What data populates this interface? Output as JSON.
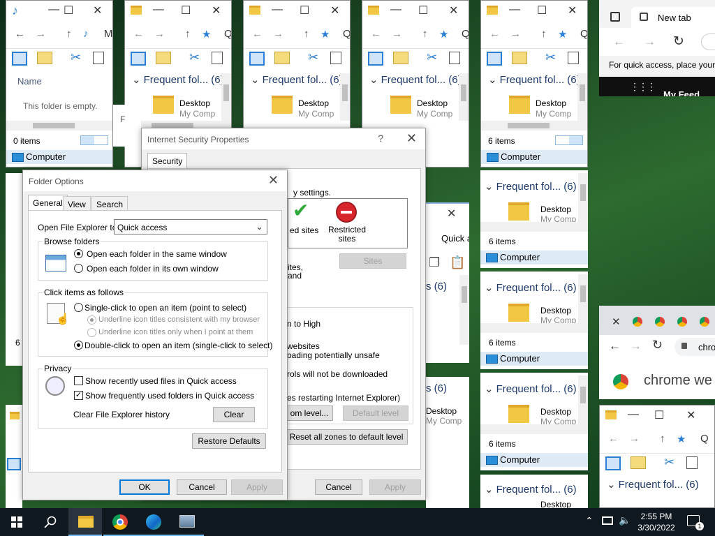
{
  "explorer": {
    "music_window": {
      "column_name": "Name",
      "empty_text": "This folder is empty.",
      "status": "0 items",
      "location": "Computer",
      "address_fragment": "M"
    },
    "frequent_folders": "Frequent fol... (6)",
    "desktop_label": "Desktop",
    "desktop_sub": "My Comp",
    "address_fragment": "Q",
    "status": "6 items",
    "location": "Computer",
    "quick_access_fragment": "Quick a",
    "count_fragment": "s (6)",
    "side_fragment_6": "6",
    "side_fragment_f": "F"
  },
  "internet_security": {
    "title": "Internet Security Properties",
    "help": "?",
    "tab_security": "Security",
    "zone_text_settings": "y settings.",
    "trusted_sites_fragment": "ed sites",
    "restricted_sites": "Restricted sites",
    "sites_button": "Sites",
    "frag_sites": "ites,",
    "frag_and": "and",
    "frag_to_high": "n to High",
    "frag_websites": "websites",
    "frag_unsafe": "oading potentially unsafe",
    "frag_controls": "rols will not be downloaded",
    "frag_restart": "es restarting Internet Explorer)",
    "custom_level": "om level...",
    "default_level": "Default level",
    "reset_all": "Reset all zones to default level",
    "cancel": "Cancel",
    "apply": "Apply"
  },
  "folder_options": {
    "title": "Folder Options",
    "tabs": [
      "General",
      "View",
      "Search"
    ],
    "open_explorer_to_label": "Open File Explorer to:",
    "open_explorer_to_value": "Quick access",
    "browse_folders": {
      "legend": "Browse folders",
      "same_window": "Open each folder in the same window",
      "own_window": "Open each folder in its own window"
    },
    "click_items": {
      "legend": "Click items as follows",
      "single_click": "Single-click to open an item (point to select)",
      "underline_browser": "Underline icon titles consistent with my browser",
      "underline_point": "Underline icon titles only when I point at them",
      "double_click": "Double-click to open an item (single-click to select)"
    },
    "privacy": {
      "legend": "Privacy",
      "recent_files": "Show recently used files in Quick access",
      "frequent_folders": "Show frequently used folders in Quick access",
      "clear_history_label": "Clear File Explorer history",
      "clear_button": "Clear"
    },
    "restore_defaults": "Restore Defaults",
    "ok": "OK",
    "cancel": "Cancel",
    "apply": "Apply"
  },
  "edge": {
    "tab_title": "New tab",
    "quick_access_text": "For quick access, place your",
    "my_feed": "My Feed"
  },
  "chrome": {
    "address_fragment": "chro",
    "page_text": "chrome we"
  },
  "taskbar": {
    "time": "2:55 PM",
    "date": "3/30/2022",
    "notification_count": "1"
  },
  "colors": {
    "accent": "#2a7fd4",
    "folder": "#f2c744",
    "taskbar": "#101820",
    "computer_row": "#dfeaf7"
  }
}
